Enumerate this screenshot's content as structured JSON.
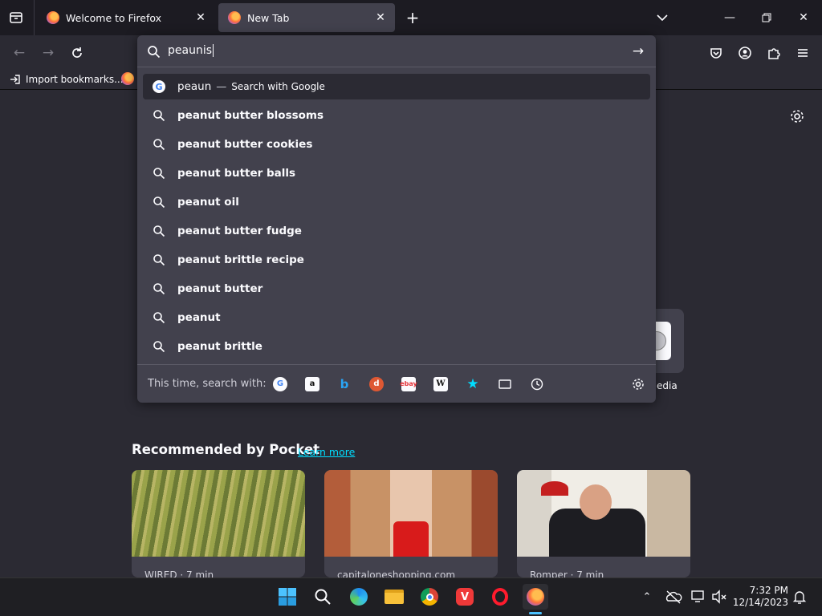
{
  "tabs": [
    {
      "title": "Welcome to Firefox"
    },
    {
      "title": "New Tab"
    }
  ],
  "toolbar": {
    "url_value": "peaunis"
  },
  "bookmarks": {
    "import_label": "Import bookmarks..."
  },
  "urlbar": {
    "heuristic": {
      "query": "peaun",
      "separator": "—",
      "action": "Search with Google"
    },
    "suggestions": [
      "peanut butter blossoms",
      "peanut butter cookies",
      "peanut butter balls",
      "peanut oil",
      "peanut butter fudge",
      "peanut brittle recipe",
      "peanut butter",
      "peanut",
      "peanut brittle"
    ],
    "search_with_label": "This time, search with:",
    "engines": [
      "google-icon",
      "amazon-icon",
      "bing-icon",
      "duckduckgo-icon",
      "ebay-icon",
      "wikipedia-icon",
      "bookmarks-icon",
      "tabs-icon",
      "history-icon"
    ]
  },
  "shortcut_partial": {
    "label": "edia"
  },
  "pocket": {
    "heading": "Recommended by Pocket",
    "learn_more": "Learn more",
    "cards": [
      {
        "source": "WIRED · 7 min"
      },
      {
        "source": "capitaloneshopping.com"
      },
      {
        "source": "Romper · 7 min"
      }
    ]
  },
  "taskbar": {
    "time": "7:32 PM",
    "date": "12/14/2023"
  },
  "colors": {
    "accent": "#00ddff",
    "popup_bg": "#42414d",
    "page_bg": "#2b2a33"
  }
}
